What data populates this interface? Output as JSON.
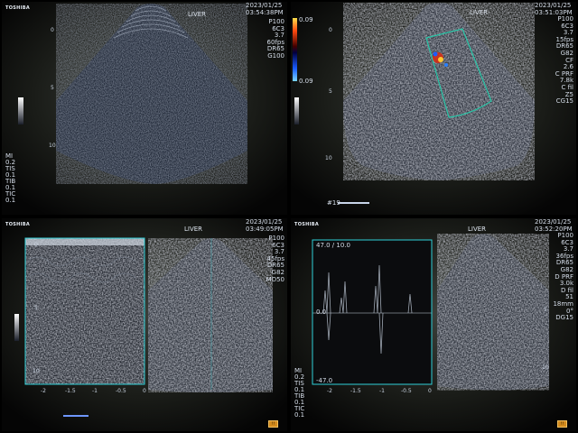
{
  "panels": [
    {
      "id": "bmode",
      "brand": "TOSHIBA",
      "organ": "LIVER",
      "date": "2023/01/25",
      "time": "03:54:38PM",
      "params": [
        "P100",
        "6C3",
        "3.7",
        "60fps",
        "DR65",
        "G100"
      ],
      "depth_marks": [
        "0",
        "5",
        "10"
      ],
      "left_info": [
        "MI",
        "0.2",
        "TIS",
        "0.1",
        "TIB",
        "0.1",
        "TIC",
        "0.1"
      ]
    },
    {
      "id": "color",
      "organ": "LIVER",
      "date": "2023/01/25",
      "time": "03:51:03PM",
      "params": [
        "P100",
        "6C3",
        "3.7",
        "15fps",
        "DR65",
        "G82",
        "CF",
        "2.6",
        "C PRF",
        "7.8k",
        "C fil",
        "Z5",
        "CG15"
      ],
      "velocity_top": "0.09",
      "velocity_bottom": "0.09",
      "depth_marks": [
        "0",
        "5",
        "10"
      ],
      "frame": "#19"
    },
    {
      "id": "mmode",
      "brand": "TOSHIBA",
      "organ": "LIVER",
      "date": "2023/01/25",
      "time": "03:49:05PM",
      "params": [
        "P100",
        "6C3",
        "3.7",
        "45fps",
        "DR65",
        "G82",
        "MD50"
      ],
      "depth_marks": [
        "0",
        "5",
        "10"
      ],
      "time_axis": [
        "-2",
        "-1.5",
        "-1",
        "-0.5",
        "0"
      ]
    },
    {
      "id": "doppler",
      "brand": "TOSHIBA",
      "organ": "LIVER",
      "date": "2023/01/25",
      "time": "03:52:20PM",
      "params": [
        "P100",
        "6C3",
        "3.7",
        "36fps",
        "DR65",
        "G82",
        "D PRF",
        "3.0k",
        "D fil",
        "51",
        "18mm",
        "0°",
        "DG15"
      ],
      "vel_label": "47.0 / 10.0",
      "vel_bottom": "-47.0",
      "baseline": "0.0",
      "depth_marks": [
        "5",
        "10"
      ],
      "time_axis": [
        "-2",
        "-1.5",
        "-1",
        "-0.5",
        "0"
      ],
      "left_info": [
        "MI",
        "0.2",
        "TIS",
        "0.1",
        "TIB",
        "0.1",
        "TIC",
        "0.1"
      ]
    }
  ]
}
